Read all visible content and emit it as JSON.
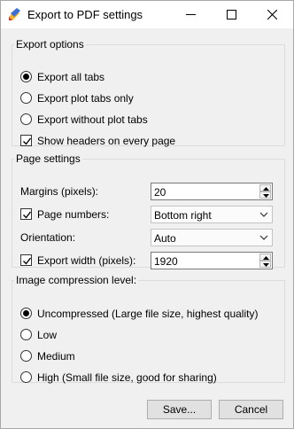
{
  "window": {
    "title": "Export to PDF settings",
    "controls": [
      "minimize-icon",
      "maximize-icon",
      "close-icon"
    ]
  },
  "export_options": {
    "legend": "Export options",
    "radios": [
      {
        "label": "Export all tabs",
        "checked": true
      },
      {
        "label": "Export plot tabs only",
        "checked": false
      },
      {
        "label": "Export without plot tabs",
        "checked": false
      }
    ],
    "show_headers": {
      "label": "Show headers on every page",
      "checked": true
    }
  },
  "page_settings": {
    "legend": "Page settings",
    "margins": {
      "label": "Margins (pixels):",
      "value": "20"
    },
    "page_numbers": {
      "label": "Page numbers:",
      "checked": true,
      "value": "Bottom right"
    },
    "orientation": {
      "label": "Orientation:",
      "value": "Auto"
    },
    "export_width": {
      "label": "Export width (pixels):",
      "checked": true,
      "value": "1920"
    }
  },
  "compression": {
    "legend": "Image compression level:",
    "radios": [
      {
        "label": "Uncompressed (Large file size, highest quality)",
        "checked": true
      },
      {
        "label": "Low",
        "checked": false
      },
      {
        "label": "Medium",
        "checked": false
      },
      {
        "label": "High (Small file size, good for sharing)",
        "checked": false
      }
    ]
  },
  "buttons": {
    "save": "Save...",
    "cancel": "Cancel"
  }
}
